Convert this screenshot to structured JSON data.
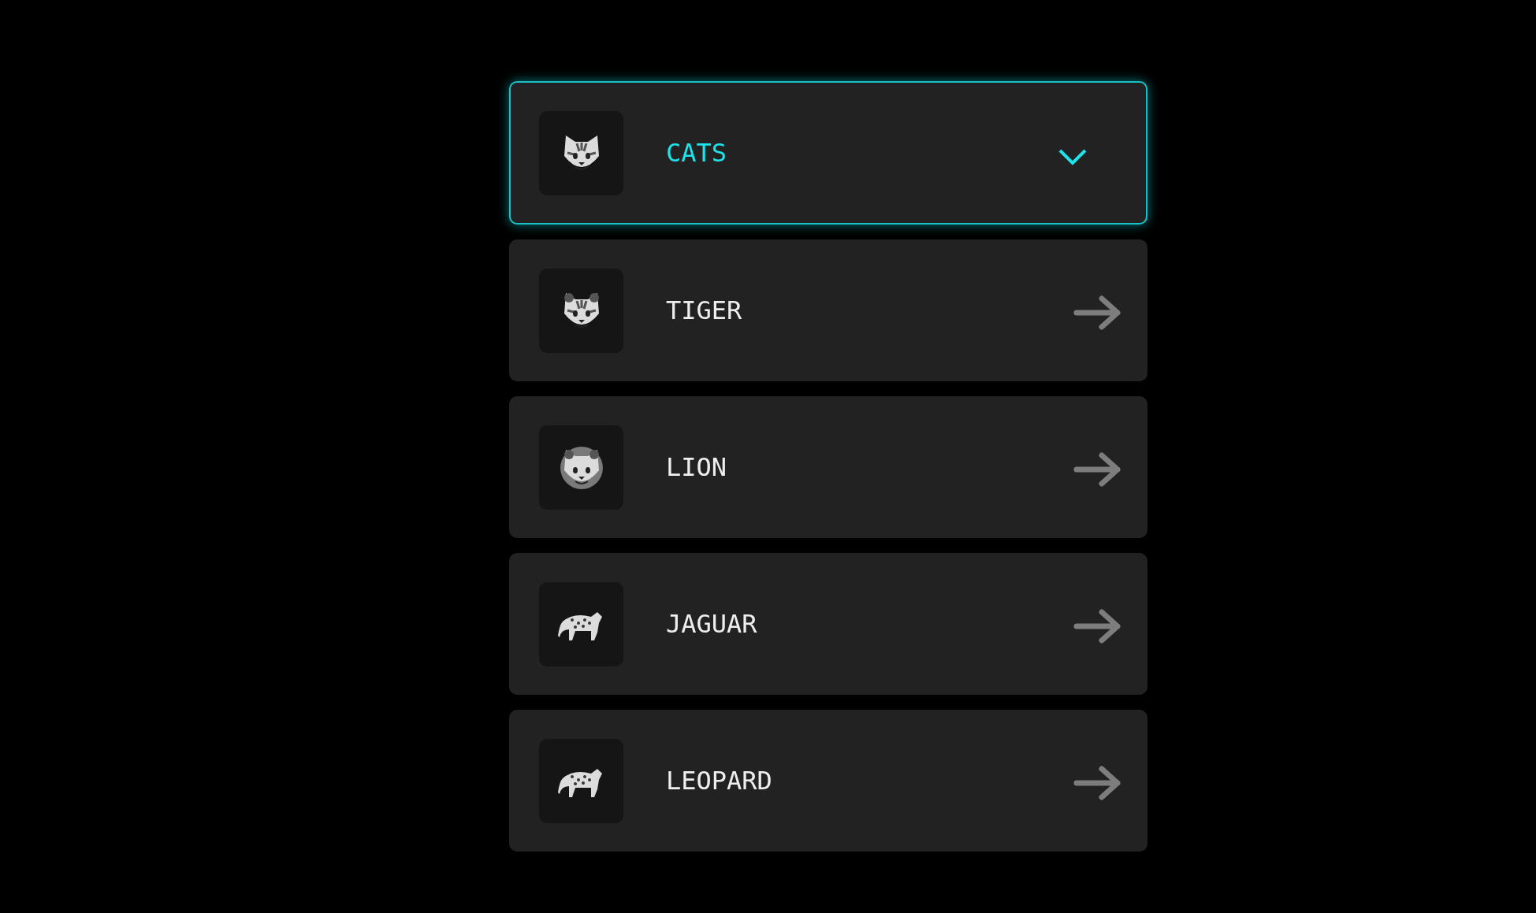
{
  "header": {
    "label": "CATS",
    "expanded": true
  },
  "items": [
    {
      "label": "TIGER"
    },
    {
      "label": "LION"
    },
    {
      "label": "JAGUAR"
    },
    {
      "label": "LEOPARD"
    }
  ]
}
